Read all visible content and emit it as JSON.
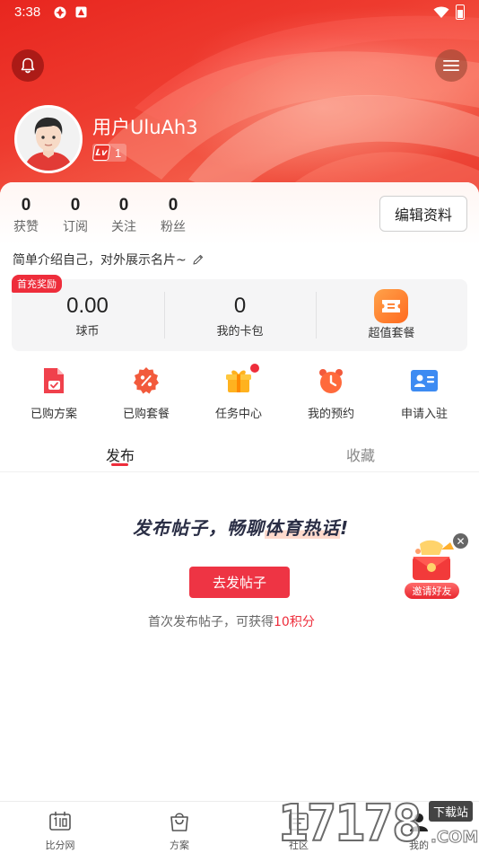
{
  "status_bar": {
    "time": "3:38"
  },
  "profile": {
    "username": "用户UluAh3",
    "level_prefix": "Lv",
    "level": "1"
  },
  "stats": [
    {
      "value": "0",
      "label": "获赞"
    },
    {
      "value": "0",
      "label": "订阅"
    },
    {
      "value": "0",
      "label": "关注"
    },
    {
      "value": "0",
      "label": "粉丝"
    }
  ],
  "edit_profile_label": "编辑资料",
  "bio_placeholder": "简单介绍自己，对外展示名片~",
  "wallet": {
    "first_recharge_tag": "首充奖励",
    "coins_value": "0.00",
    "coins_label": "球币",
    "card_value": "0",
    "card_label": "我的卡包",
    "package_label": "超值套餐"
  },
  "functions": [
    {
      "label": "已购方案",
      "icon": "document-check-icon"
    },
    {
      "label": "已购套餐",
      "icon": "discount-badge-icon"
    },
    {
      "label": "任务中心",
      "icon": "gift-icon"
    },
    {
      "label": "我的预约",
      "icon": "alarm-clock-icon"
    },
    {
      "label": "申请入驻",
      "icon": "id-card-icon"
    }
  ],
  "tabs": {
    "publish": "发布",
    "favorites": "收藏"
  },
  "empty_state": {
    "promo_part1": "发布帖子，畅聊",
    "promo_highlight": "体育热话",
    "promo_end": "!",
    "button_label": "去发帖子",
    "reward_prefix": "首次发布帖子，可获得",
    "reward_highlight": "10积分",
    "reward_suffix": ""
  },
  "invite_label": "邀请好友",
  "bottom_nav": [
    {
      "label": "比分网"
    },
    {
      "label": "方案"
    },
    {
      "label": "社区"
    },
    {
      "label": "我的"
    }
  ],
  "watermark": {
    "digits": "17178",
    "tag": "下载站",
    "suffix": ".COM"
  },
  "colors": {
    "brand_red": "#ee2d3b",
    "hero_red": "#e8261f"
  }
}
